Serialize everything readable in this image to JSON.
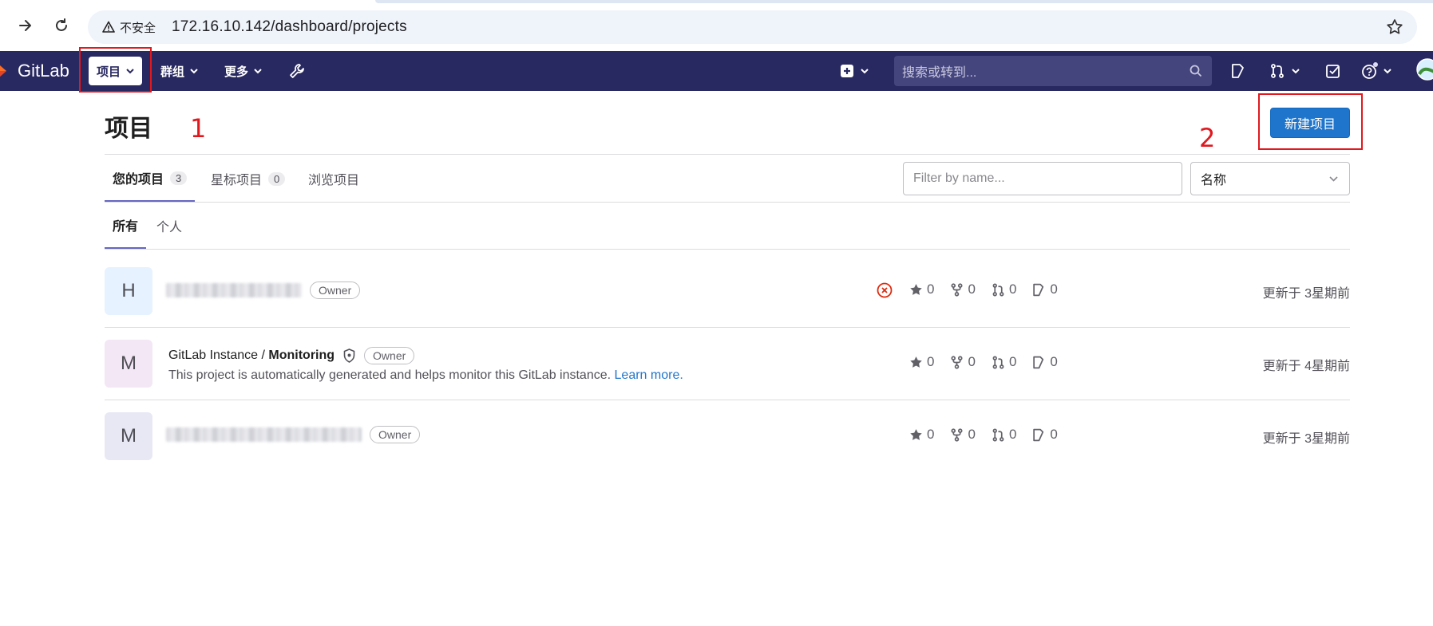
{
  "browser": {
    "security_label": "不安全",
    "url": "172.16.10.142/dashboard/projects"
  },
  "topbar": {
    "brand": "GitLab",
    "nav": [
      "项目",
      "群组",
      "更多"
    ],
    "search_placeholder": "搜索或转到..."
  },
  "page": {
    "title": "项目",
    "new_project_button": "新建项目",
    "tabs": [
      {
        "label": "您的项目",
        "count": "3"
      },
      {
        "label": "星标项目",
        "count": "0"
      },
      {
        "label": "浏览项目"
      }
    ],
    "subtabs": [
      "所有",
      "个人"
    ],
    "filter_placeholder": "Filter by name...",
    "sort_selected": "名称"
  },
  "annotations": [
    "1",
    "2"
  ],
  "projects": [
    {
      "avatar": "H",
      "owner_badge": "Owner",
      "stars": "0",
      "forks": "0",
      "merge_requests": "0",
      "issues": "0",
      "updated": "更新于 3星期前"
    },
    {
      "avatar": "M",
      "namespace": "GitLab Instance / ",
      "name": "Monitoring",
      "owner_badge": "Owner",
      "description": "This project is automatically generated and helps monitor this GitLab instance.",
      "description_link": "Learn more.",
      "stars": "0",
      "forks": "0",
      "merge_requests": "0",
      "issues": "0",
      "updated": "更新于 4星期前"
    },
    {
      "avatar": "M",
      "owner_badge": "Owner",
      "stars": "0",
      "forks": "0",
      "merge_requests": "0",
      "issues": "0",
      "updated": "更新于 3星期前"
    }
  ],
  "colors": {
    "navbar": "#292961",
    "primary_button": "#1f75cb",
    "annotation_red": "#e0191f",
    "avatar_h": "#e6f2ff",
    "avatar_m1": "#f3e6f5",
    "avatar_m2": "#e8e8f5"
  }
}
